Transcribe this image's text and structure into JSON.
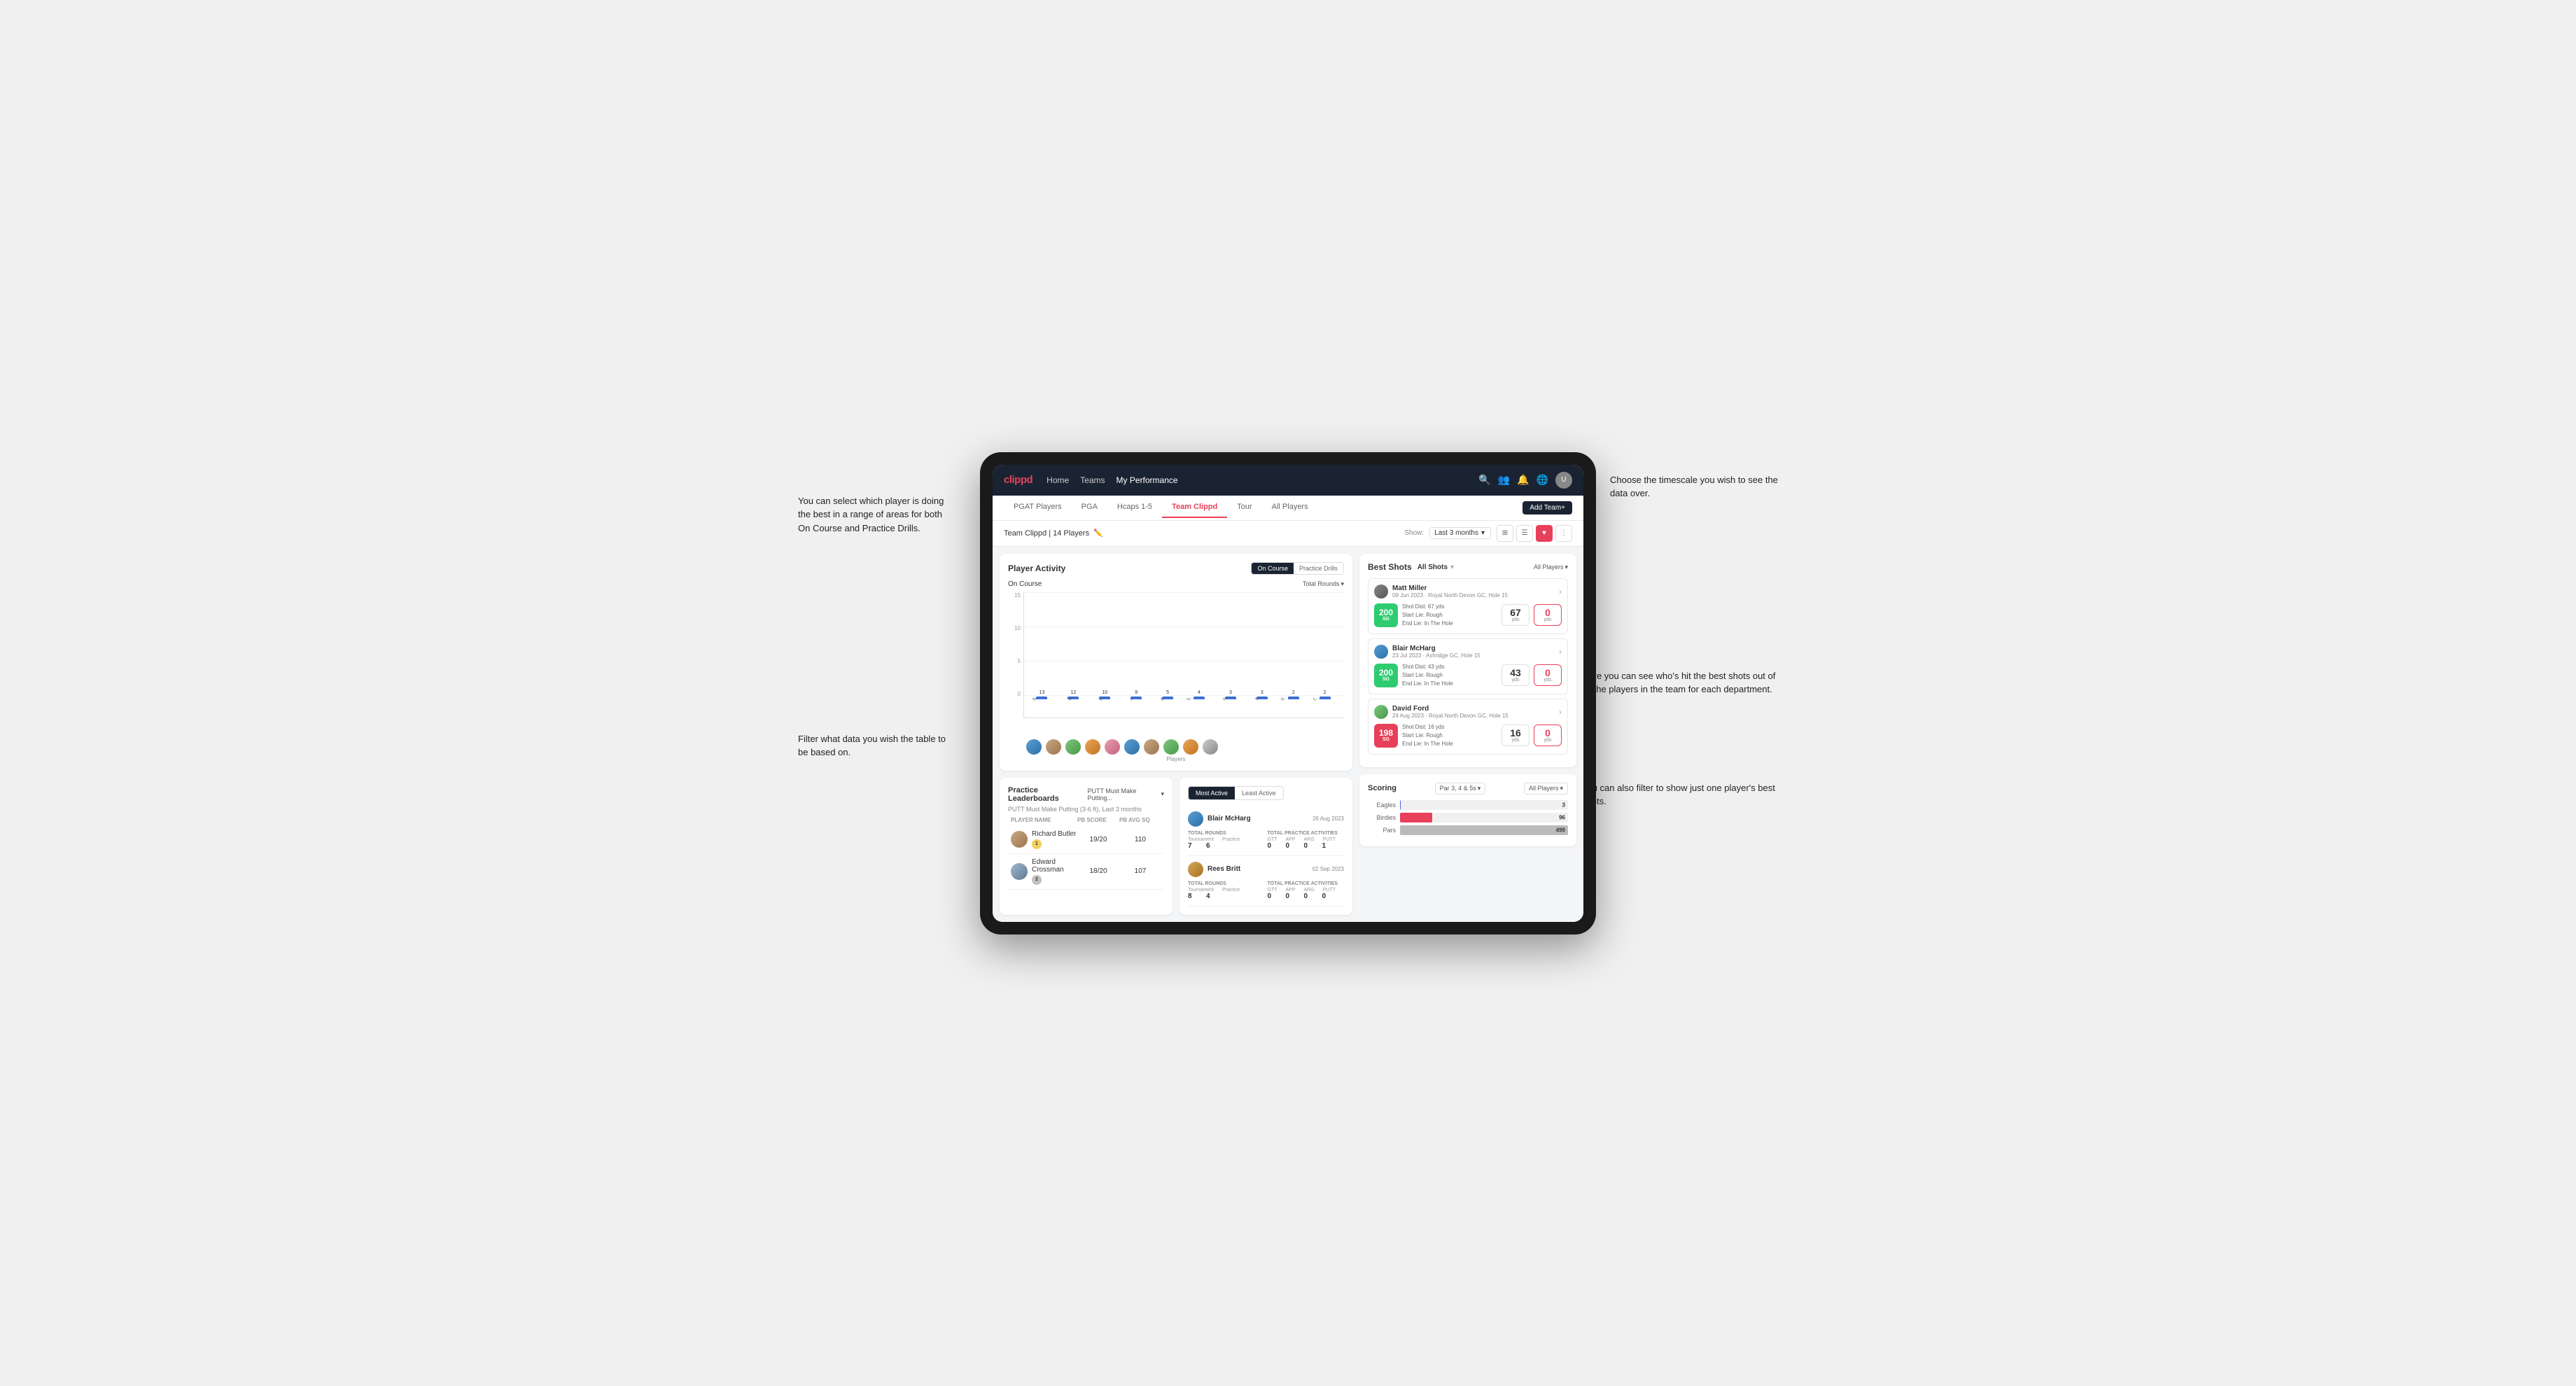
{
  "brand": "clippd",
  "nav": {
    "links": [
      "Home",
      "Teams",
      "My Performance"
    ],
    "icons": [
      "search",
      "users",
      "bell",
      "globe",
      "user"
    ],
    "active_link": "My Performance"
  },
  "sub_tabs": [
    "PGAT Players",
    "PGA",
    "Hcaps 1-5",
    "Team Clippd",
    "Tour",
    "All Players"
  ],
  "active_sub_tab": "Team Clippd",
  "add_team_label": "Add Team+",
  "filter_bar": {
    "team_info": "Team Clippd | 14 Players",
    "show_label": "Show:",
    "date_filter": "Last 3 months",
    "view_icons": [
      "grid",
      "list",
      "heart",
      "settings"
    ]
  },
  "player_activity": {
    "title": "Player Activity",
    "toggle_options": [
      "On Course",
      "Practice Drills"
    ],
    "active_toggle": "On Course",
    "chart": {
      "subtitle": "On Course",
      "y_axis": [
        "15",
        "10",
        "5",
        "0"
      ],
      "dropdown_label": "Total Rounds",
      "x_axis_label": "Players",
      "bars": [
        {
          "name": "B. McHarg",
          "value": 13
        },
        {
          "name": "B. Britt",
          "value": 12
        },
        {
          "name": "D. Ford",
          "value": 10
        },
        {
          "name": "J. Coles",
          "value": 9
        },
        {
          "name": "E. Ebert",
          "value": 5
        },
        {
          "name": "G. Billingham",
          "value": 4
        },
        {
          "name": "R. Butler",
          "value": 3
        },
        {
          "name": "M. Miller",
          "value": 3
        },
        {
          "name": "E. Crossman",
          "value": 2
        },
        {
          "name": "L. Robertson",
          "value": 2
        }
      ]
    }
  },
  "best_shots": {
    "title": "Best Shots",
    "tabs": [
      "All Shots",
      "All Players"
    ],
    "players": [
      {
        "name": "Matt Miller",
        "meta": "09 Jun 2023 · Royal North Devon GC, Hole 15",
        "badge_num": "200",
        "badge_sub": "SG",
        "shot_dist": "Shot Dist: 67 yds",
        "start_lie": "Start Lie: Rough",
        "end_lie": "End Lie: In The Hole",
        "stat1": "67",
        "stat1_label": "yds",
        "stat2": "0",
        "stat2_label": "yds"
      },
      {
        "name": "Blair McHarg",
        "meta": "23 Jul 2023 · Ashridge GC, Hole 15",
        "badge_num": "200",
        "badge_sub": "SG",
        "shot_dist": "Shot Dist: 43 yds",
        "start_lie": "Start Lie: Rough",
        "end_lie": "End Lie: In The Hole",
        "stat1": "43",
        "stat1_label": "yds",
        "stat2": "0",
        "stat2_label": "yds"
      },
      {
        "name": "David Ford",
        "meta": "24 Aug 2023 · Royal North Devon GC, Hole 15",
        "badge_num": "198",
        "badge_sub": "SG",
        "shot_dist": "Shot Dist: 16 yds",
        "start_lie": "Start Lie: Rough",
        "end_lie": "End Lie: In The Hole",
        "stat1": "16",
        "stat1_label": "yds",
        "stat2": "0",
        "stat2_label": "yds"
      }
    ]
  },
  "practice_leaderboards": {
    "title": "Practice Leaderboards",
    "dropdown_label": "PUTT Must Make Putting...",
    "subtitle": "PUTT Must Make Putting (3-6 ft), Last 3 months",
    "columns": [
      "PLAYER NAME",
      "PB SCORE",
      "PB AVG SQ"
    ],
    "rows": [
      {
        "name": "Richard Butler",
        "rank": "1",
        "score": "19/20",
        "avg": "110"
      },
      {
        "name": "Edward Crossman",
        "rank": "2",
        "score": "18/20",
        "avg": "107"
      }
    ]
  },
  "most_active": {
    "tabs": [
      "Most Active",
      "Least Active"
    ],
    "active_tab": "Most Active",
    "players": [
      {
        "name": "Blair McHarg",
        "date": "26 Aug 2023",
        "rounds_label": "Total Rounds",
        "tournament": "7",
        "practice": "6",
        "practice_label": "Total Practice Activities",
        "gtt": "0",
        "app": "0",
        "arg": "0",
        "putt": "1"
      },
      {
        "name": "Rees Britt",
        "date": "02 Sep 2023",
        "rounds_label": "Total Rounds",
        "tournament": "8",
        "practice": "4",
        "practice_label": "Total Practice Activities",
        "gtt": "0",
        "app": "0",
        "arg": "0",
        "putt": "0"
      }
    ]
  },
  "scoring": {
    "title": "Scoring",
    "par_dropdown": "Par 3, 4 & 5s",
    "players_dropdown": "All Players",
    "bars": [
      {
        "label": "Eagles",
        "value": 3,
        "max": 500,
        "color": "#3b6fd4"
      },
      {
        "label": "Birdies",
        "value": 96,
        "max": 500,
        "color": "#e8405a"
      },
      {
        "label": "Pars",
        "value": 499,
        "max": 500,
        "color": "#ccc"
      }
    ]
  },
  "annotations": {
    "top_left": "You can select which player is doing the best in a range of areas for both On Course and Practice Drills.",
    "top_right": "Choose the timescale you wish to see the data over.",
    "mid_left": "Filter what data you wish the table to be based on.",
    "mid_right": "Here you can see who's hit the best shots out of all the players in the team for each department.",
    "bottom_right": "You can also filter to show just one player's best shots."
  }
}
